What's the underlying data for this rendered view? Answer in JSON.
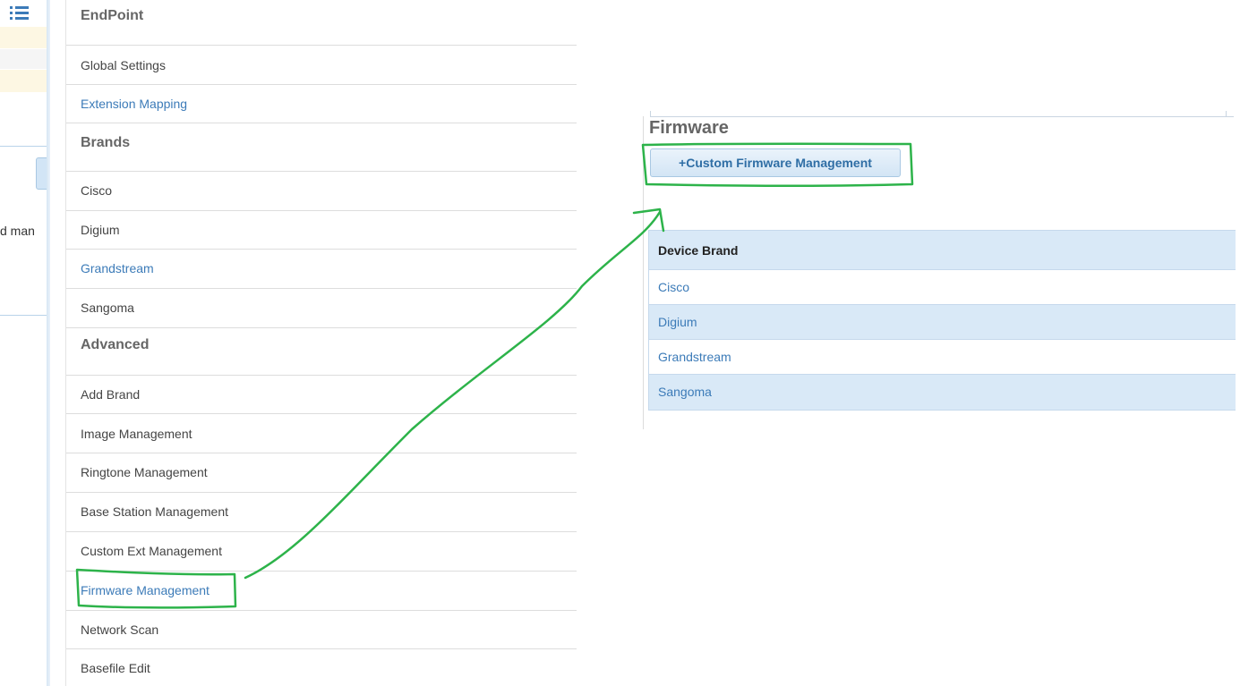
{
  "background": {
    "cut_text": "d man",
    "list_icon": "list-icon"
  },
  "menu": {
    "sections": [
      {
        "heading": "EndPoint",
        "items": [
          {
            "label": "Global Settings",
            "active": false
          },
          {
            "label": "Extension Mapping",
            "active": true
          }
        ]
      },
      {
        "heading": "Brands",
        "items": [
          {
            "label": "Cisco",
            "active": false
          },
          {
            "label": "Digium",
            "active": false
          },
          {
            "label": "Grandstream",
            "active": true
          },
          {
            "label": "Sangoma",
            "active": false
          }
        ]
      },
      {
        "heading": "Advanced",
        "items": [
          {
            "label": "Add Brand",
            "active": false
          },
          {
            "label": "Image Management",
            "active": false
          },
          {
            "label": "Ringtone Management",
            "active": false
          },
          {
            "label": "Base Station Management",
            "active": false
          },
          {
            "label": "Custom Ext Management",
            "active": false
          },
          {
            "label": "Firmware Management",
            "active": true
          },
          {
            "label": "Network Scan",
            "active": false
          },
          {
            "label": "Basefile Edit",
            "active": false
          }
        ]
      }
    ]
  },
  "firmware": {
    "title": "Firmware",
    "custom_button": "+Custom Firmware Management",
    "table": {
      "header": "Device Brand",
      "rows": [
        "Cisco",
        "Digium",
        "Grandstream",
        "Sangoma"
      ]
    }
  },
  "colors": {
    "annotation": "#2db34a",
    "link": "#3c7bb8",
    "table_stripe": "#d9e9f7"
  }
}
